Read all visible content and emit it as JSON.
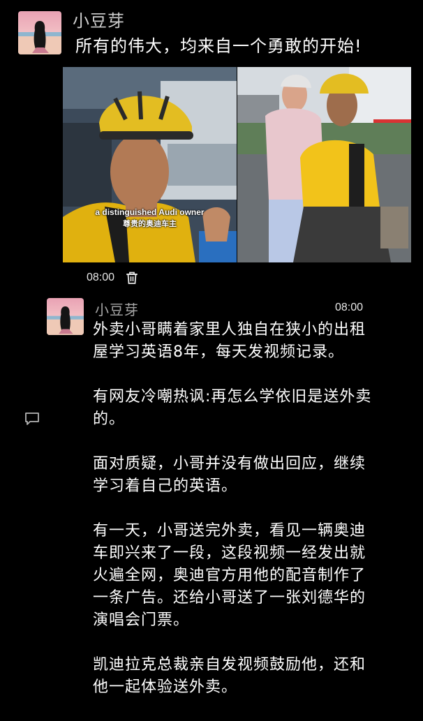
{
  "post1": {
    "author": "小豆芽",
    "caption": "所有的伟大，均来自一个勇敢的开始!",
    "media": {
      "subtitle_en": "a distinguished Audi owner",
      "subtitle_zh": "尊贵的奥迪车主"
    },
    "time": "08:00",
    "delete_icon": "trash-icon"
  },
  "post2": {
    "author": "小豆芽",
    "time": "08:00",
    "comment_icon": "comment-icon",
    "paragraphs": [
      [
        "外卖小哥瞒着家里人独自在狭小的出租",
        "屋学习英语8年，每天发视频记录。"
      ],
      [
        "有网友冷嘲热讽:再怎么学依旧是送外卖",
        "的。"
      ],
      [
        "面对质疑，小哥并没有做出回应，继续",
        "学习着自己的英语。"
      ],
      [
        "有一天，小哥送完外卖，看见一辆奥迪",
        "车即兴来了一段，这段视频一经发出就",
        "火遍全网，奥迪官方用他的配音制作了",
        "一条广告。还给小哥送了一张刘德华的",
        "演唱会门票。"
      ],
      [
        "凯迪拉克总裁亲自发视频鼓励他，还和",
        "他一起体验送外卖。"
      ]
    ]
  },
  "colors": {
    "background": "#000000",
    "text": "#ffffff",
    "author": "#a8a8a8",
    "helmet": "#e6b800"
  }
}
